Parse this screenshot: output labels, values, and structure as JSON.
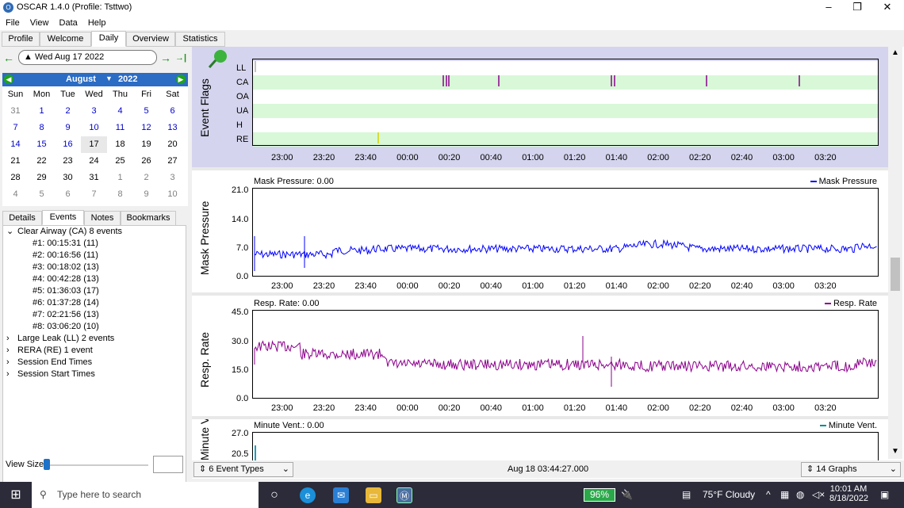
{
  "window": {
    "title": "OSCAR 1.4.0 (Profile: Tsttwo)",
    "min": "–",
    "max": "❐",
    "close": "✕"
  },
  "menu": [
    "File",
    "View",
    "Data",
    "Help"
  ],
  "tabs": [
    "Profile",
    "Welcome",
    "Daily",
    "Overview",
    "Statistics"
  ],
  "date_nav": {
    "back": "←",
    "date": "Wed Aug 17 2022",
    "forward": "→",
    "last": "→|"
  },
  "calendar": {
    "month": "August",
    "year": "2022",
    "weekdays": [
      "Sun",
      "Mon",
      "Tue",
      "Wed",
      "Thu",
      "Fri",
      "Sat"
    ],
    "rows": [
      [
        "31",
        "1",
        "2",
        "3",
        "4",
        "5",
        "6"
      ],
      [
        "7",
        "8",
        "9",
        "10",
        "11",
        "12",
        "13"
      ],
      [
        "14",
        "15",
        "16",
        "17",
        "18",
        "19",
        "20"
      ],
      [
        "21",
        "22",
        "23",
        "24",
        "25",
        "26",
        "27"
      ],
      [
        "28",
        "29",
        "30",
        "31",
        "1",
        "2",
        "3"
      ],
      [
        "4",
        "5",
        "6",
        "7",
        "8",
        "9",
        "10"
      ]
    ]
  },
  "subtabs": [
    "Details",
    "Events",
    "Notes",
    "Bookmarks"
  ],
  "events_tree": [
    {
      "label": "Clear Airway (CA) 8 events",
      "expanded": true,
      "children": [
        "#1: 00:15:31 (11)",
        "#2: 00:16:56 (11)",
        "#3: 00:18:02 (13)",
        "#4: 00:42:28 (13)",
        "#5: 01:36:03 (17)",
        "#6: 01:37:28 (14)",
        "#7: 02:21:56 (13)",
        "#8: 03:06:20 (10)"
      ]
    },
    {
      "label": "Large Leak (LL) 2 events",
      "expanded": false
    },
    {
      "label": "RERA (RE) 1 event",
      "expanded": false
    },
    {
      "label": "Session End Times",
      "expanded": false
    },
    {
      "label": "Session Start Times",
      "expanded": false
    }
  ],
  "view_size_label": "View Size",
  "time_ticks": [
    "23:00",
    "23:20",
    "23:40",
    "00:00",
    "00:20",
    "00:40",
    "01:00",
    "01:20",
    "01:40",
    "02:00",
    "02:20",
    "02:40",
    "03:00",
    "03:20"
  ],
  "event_flags": {
    "ylabel": "Event Flags",
    "rows": [
      "LL",
      "CA",
      "OA",
      "UA",
      "H",
      "RE"
    ]
  },
  "graphs": [
    {
      "id": "mask",
      "ylabel": "Mask Pressure",
      "title": "Mask Pressure: 0.00",
      "legend": "Mask Pressure",
      "color": "#0000ff",
      "yticks": [
        "21.0",
        "14.0",
        "7.0",
        "0.0"
      ]
    },
    {
      "id": "resp",
      "ylabel": "Resp. Rate",
      "title": "Resp. Rate: 0.00",
      "legend": "Resp. Rate",
      "color": "#8b008b",
      "yticks": [
        "45.0",
        "30.0",
        "15.0",
        "0.0"
      ]
    },
    {
      "id": "minvent",
      "ylabel": "Minute Vent.",
      "title": "Minute Vent.: 0.00",
      "legend": "Minute Vent.",
      "color": "#008b8b",
      "yticks": [
        "27.0",
        "20.5"
      ]
    }
  ],
  "bottom": {
    "event_types": "6 Event Types",
    "timestamp": "Aug 18 03:44:27.000",
    "graphs_count": "14 Graphs"
  },
  "taskbar": {
    "search_placeholder": "Type here to search",
    "battery": "96%",
    "weather": "75°F  Cloudy",
    "time": "10:01 AM",
    "date": "8/18/2022"
  },
  "colors": {
    "accent": "#2b6cc4",
    "flag_ca": "#8b008b",
    "flag_re": "#d4d400",
    "flag_band": "#d8f8d8"
  }
}
